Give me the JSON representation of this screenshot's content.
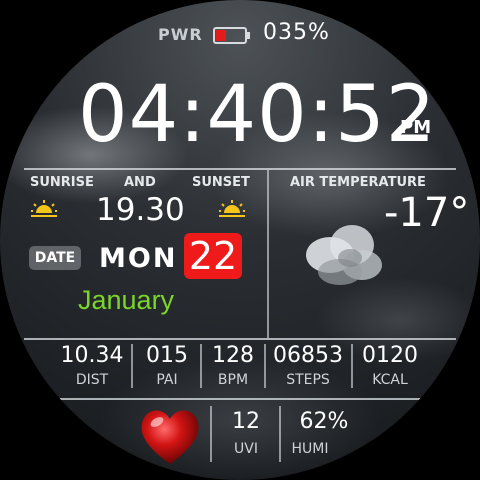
{
  "status": {
    "pwr_label": "PWR",
    "battery_percent": "035%",
    "battery_level": 0.35,
    "battery_color": "#e31b1b"
  },
  "clock": {
    "time": "04:40:52",
    "ampm": "PM"
  },
  "sun": {
    "sunrise_label": "SUNRISE",
    "and_label": "AND",
    "sunset_label": "SUNSET",
    "value": "19.30"
  },
  "date": {
    "badge": "DATE",
    "weekday": "MON",
    "day": "22",
    "month": "January",
    "day_color": "#ef1b1b",
    "month_color": "#7ad629"
  },
  "weather": {
    "label": "AIR TEMPERATURE",
    "temperature": "-17°"
  },
  "stats": [
    {
      "value": "10.34",
      "label": "DIST"
    },
    {
      "value": "015",
      "label": "PAI"
    },
    {
      "value": "128",
      "label": "BPM"
    },
    {
      "value": "06853",
      "label": "STEPS"
    },
    {
      "value": "0120",
      "label": "KCAL"
    }
  ],
  "bottom": {
    "uvi_value": "12",
    "uvi_label": "UVI",
    "humi_value": "62%",
    "humi_label": "HUMI"
  },
  "icons": {
    "battery": "battery-icon",
    "sunrise": "sunrise-icon",
    "sunset": "sunset-icon",
    "weather": "cloud-icon",
    "heart": "heart-icon"
  }
}
